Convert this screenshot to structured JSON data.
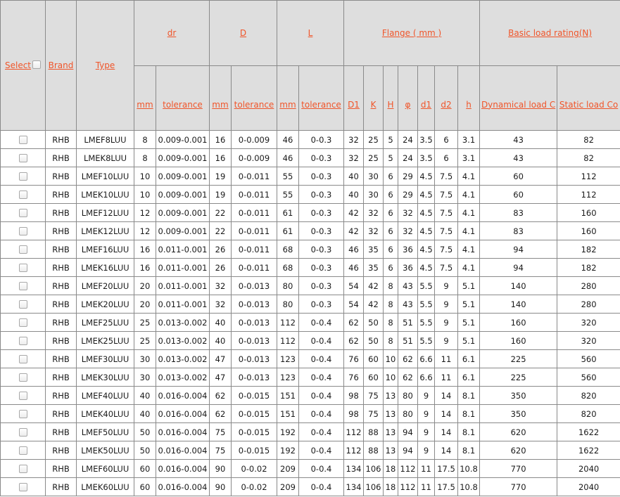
{
  "header": {
    "select": "Select",
    "brand": "Brand",
    "type": "Type",
    "dr": "dr",
    "D": "D",
    "L": "L",
    "flange": "Flange ( mm )",
    "basic_load": "Basic load rating(N)",
    "sub": [
      "mm",
      "tolerance",
      "mm",
      "tolerance",
      "mm",
      "tolerance",
      "D1",
      "K",
      "H",
      "φ",
      "d1",
      "d2",
      "h",
      "Dynamical load C",
      "Static load Co"
    ]
  },
  "rows": [
    [
      "RHB",
      "LMEF8LUU",
      "8",
      "0.009-0.001",
      "16",
      "0-0.009",
      "46",
      "0-0.3",
      "32",
      "25",
      "5",
      "24",
      "3.5",
      "6",
      "3.1",
      "43",
      "82"
    ],
    [
      "RHB",
      "LMEK8LUU",
      "8",
      "0.009-0.001",
      "16",
      "0-0.009",
      "46",
      "0-0.3",
      "32",
      "25",
      "5",
      "24",
      "3.5",
      "6",
      "3.1",
      "43",
      "82"
    ],
    [
      "RHB",
      "LMEF10LUU",
      "10",
      "0.009-0.001",
      "19",
      "0-0.011",
      "55",
      "0-0.3",
      "40",
      "30",
      "6",
      "29",
      "4.5",
      "7.5",
      "4.1",
      "60",
      "112"
    ],
    [
      "RHB",
      "LMEK10LUU",
      "10",
      "0.009-0.001",
      "19",
      "0-0.011",
      "55",
      "0-0.3",
      "40",
      "30",
      "6",
      "29",
      "4.5",
      "7.5",
      "4.1",
      "60",
      "112"
    ],
    [
      "RHB",
      "LMEF12LUU",
      "12",
      "0.009-0.001",
      "22",
      "0-0.011",
      "61",
      "0-0.3",
      "42",
      "32",
      "6",
      "32",
      "4.5",
      "7.5",
      "4.1",
      "83",
      "160"
    ],
    [
      "RHB",
      "LMEK12LUU",
      "12",
      "0.009-0.001",
      "22",
      "0-0.011",
      "61",
      "0-0.3",
      "42",
      "32",
      "6",
      "32",
      "4.5",
      "7.5",
      "4.1",
      "83",
      "160"
    ],
    [
      "RHB",
      "LMEF16LUU",
      "16",
      "0.011-0.001",
      "26",
      "0-0.011",
      "68",
      "0-0.3",
      "46",
      "35",
      "6",
      "36",
      "4.5",
      "7.5",
      "4.1",
      "94",
      "182"
    ],
    [
      "RHB",
      "LMEK16LUU",
      "16",
      "0.011-0.001",
      "26",
      "0-0.011",
      "68",
      "0-0.3",
      "46",
      "35",
      "6",
      "36",
      "4.5",
      "7.5",
      "4.1",
      "94",
      "182"
    ],
    [
      "RHB",
      "LMEF20LUU",
      "20",
      "0.011-0.001",
      "32",
      "0-0.013",
      "80",
      "0-0.3",
      "54",
      "42",
      "8",
      "43",
      "5.5",
      "9",
      "5.1",
      "140",
      "280"
    ],
    [
      "RHB",
      "LMEK20LUU",
      "20",
      "0.011-0.001",
      "32",
      "0-0.013",
      "80",
      "0-0.3",
      "54",
      "42",
      "8",
      "43",
      "5.5",
      "9",
      "5.1",
      "140",
      "280"
    ],
    [
      "RHB",
      "LMEF25LUU",
      "25",
      "0.013-0.002",
      "40",
      "0-0.013",
      "112",
      "0-0.4",
      "62",
      "50",
      "8",
      "51",
      "5.5",
      "9",
      "5.1",
      "160",
      "320"
    ],
    [
      "RHB",
      "LMEK25LUU",
      "25",
      "0.013-0.002",
      "40",
      "0-0.013",
      "112",
      "0-0.4",
      "62",
      "50",
      "8",
      "51",
      "5.5",
      "9",
      "5.1",
      "160",
      "320"
    ],
    [
      "RHB",
      "LMEF30LUU",
      "30",
      "0.013-0.002",
      "47",
      "0-0.013",
      "123",
      "0-0.4",
      "76",
      "60",
      "10",
      "62",
      "6.6",
      "11",
      "6.1",
      "225",
      "560"
    ],
    [
      "RHB",
      "LMEK30LUU",
      "30",
      "0.013-0.002",
      "47",
      "0-0.013",
      "123",
      "0-0.4",
      "76",
      "60",
      "10",
      "62",
      "6.6",
      "11",
      "6.1",
      "225",
      "560"
    ],
    [
      "RHB",
      "LMEF40LUU",
      "40",
      "0.016-0.004",
      "62",
      "0-0.015",
      "151",
      "0-0.4",
      "98",
      "75",
      "13",
      "80",
      "9",
      "14",
      "8.1",
      "350",
      "820"
    ],
    [
      "RHB",
      "LMEK40LUU",
      "40",
      "0.016-0.004",
      "62",
      "0-0.015",
      "151",
      "0-0.4",
      "98",
      "75",
      "13",
      "80",
      "9",
      "14",
      "8.1",
      "350",
      "820"
    ],
    [
      "RHB",
      "LMEF50LUU",
      "50",
      "0.016-0.004",
      "75",
      "0-0.015",
      "192",
      "0-0.4",
      "112",
      "88",
      "13",
      "94",
      "9",
      "14",
      "8.1",
      "620",
      "1622"
    ],
    [
      "RHB",
      "LMEK50LUU",
      "50",
      "0.016-0.004",
      "75",
      "0-0.015",
      "192",
      "0-0.4",
      "112",
      "88",
      "13",
      "94",
      "9",
      "14",
      "8.1",
      "620",
      "1622"
    ],
    [
      "RHB",
      "LMEF60LUU",
      "60",
      "0.016-0.004",
      "90",
      "0-0.02",
      "209",
      "0-0.4",
      "134",
      "106",
      "18",
      "112",
      "11",
      "17.5",
      "10.8",
      "770",
      "2040"
    ],
    [
      "RHB",
      "LMEK60LUU",
      "60",
      "0.016-0.004",
      "90",
      "0-0.02",
      "209",
      "0-0.4",
      "134",
      "106",
      "18",
      "112",
      "11",
      "17.5",
      "10.8",
      "770",
      "2040"
    ]
  ]
}
